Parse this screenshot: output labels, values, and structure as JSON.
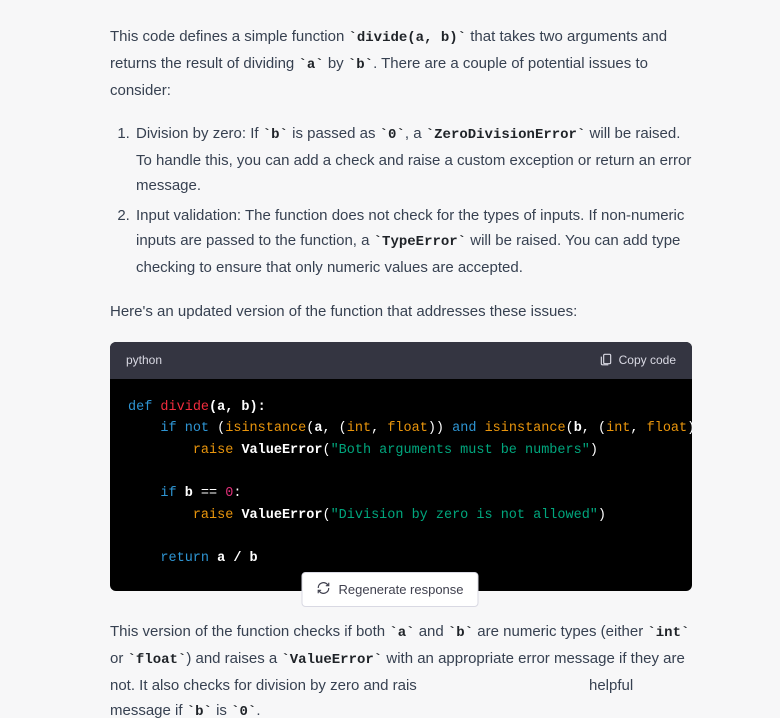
{
  "intro": {
    "t1": "This code defines a simple function ",
    "c1": "`divide(a, b)`",
    "t2": " that takes two arguments and returns the result of dividing ",
    "c2": "`a`",
    "t3": " by ",
    "c3": "`b`",
    "t4": ". There are a couple of potential issues to consider:"
  },
  "issues": {
    "item1": {
      "t1": "Division by zero: If ",
      "c1": "`b`",
      "t2": " is passed as ",
      "c2": "`0`",
      "t3": ", a ",
      "c3": "`ZeroDivisionError`",
      "t4": " will be raised. To handle this, you can add a check and raise a custom exception or return an error message."
    },
    "item2": {
      "t1": "Input validation: The function does not check for the types of inputs. If non-numeric inputs are passed to the function, a ",
      "c1": "`TypeError`",
      "t2": " will be raised. You can add type checking to ensure that only numeric values are accepted."
    }
  },
  "lead": "Here's an updated version of the function that addresses these issues:",
  "code_header": {
    "lang": "python",
    "copy_label": "Copy code"
  },
  "code": {
    "kw_def": "def",
    "fn": "divide",
    "args": "(a, b):",
    "kw_if": "if",
    "kw_not": "not",
    "kw_and": "and",
    "kw_return": "return",
    "bi_isinstance": "isinstance",
    "bi_raise": "raise",
    "bi_int": "int",
    "bi_float": "float",
    "vs_a": "a",
    "vs_b": "b",
    "op_open": "(",
    "op_close": ")",
    "op_comma": ", ",
    "op_colon": ":",
    "op_eq": " == ",
    "op_div": " / ",
    "cls_valueerror": "ValueError",
    "str1": "\"Both arguments must be numbers\"",
    "str2": "\"Division by zero is not allowed\"",
    "num_zero": "0"
  },
  "outro": {
    "t1": "This version of the function checks if both ",
    "c1": "`a`",
    "t2": " and ",
    "c2": "`b`",
    "t3": " are numeric types (either ",
    "c3": "`int`",
    "t4": " or ",
    "c4": "`float`",
    "t5": ") and raises a ",
    "c5": "`ValueError`",
    "t6": " with an appropriate error message if they are not. It also checks for division by zero and rais",
    "t7": " helpful message if ",
    "c6": "`b`",
    "t8": " is ",
    "c7": "`0`",
    "t9": "."
  },
  "regenerate_label": "Regenerate response"
}
